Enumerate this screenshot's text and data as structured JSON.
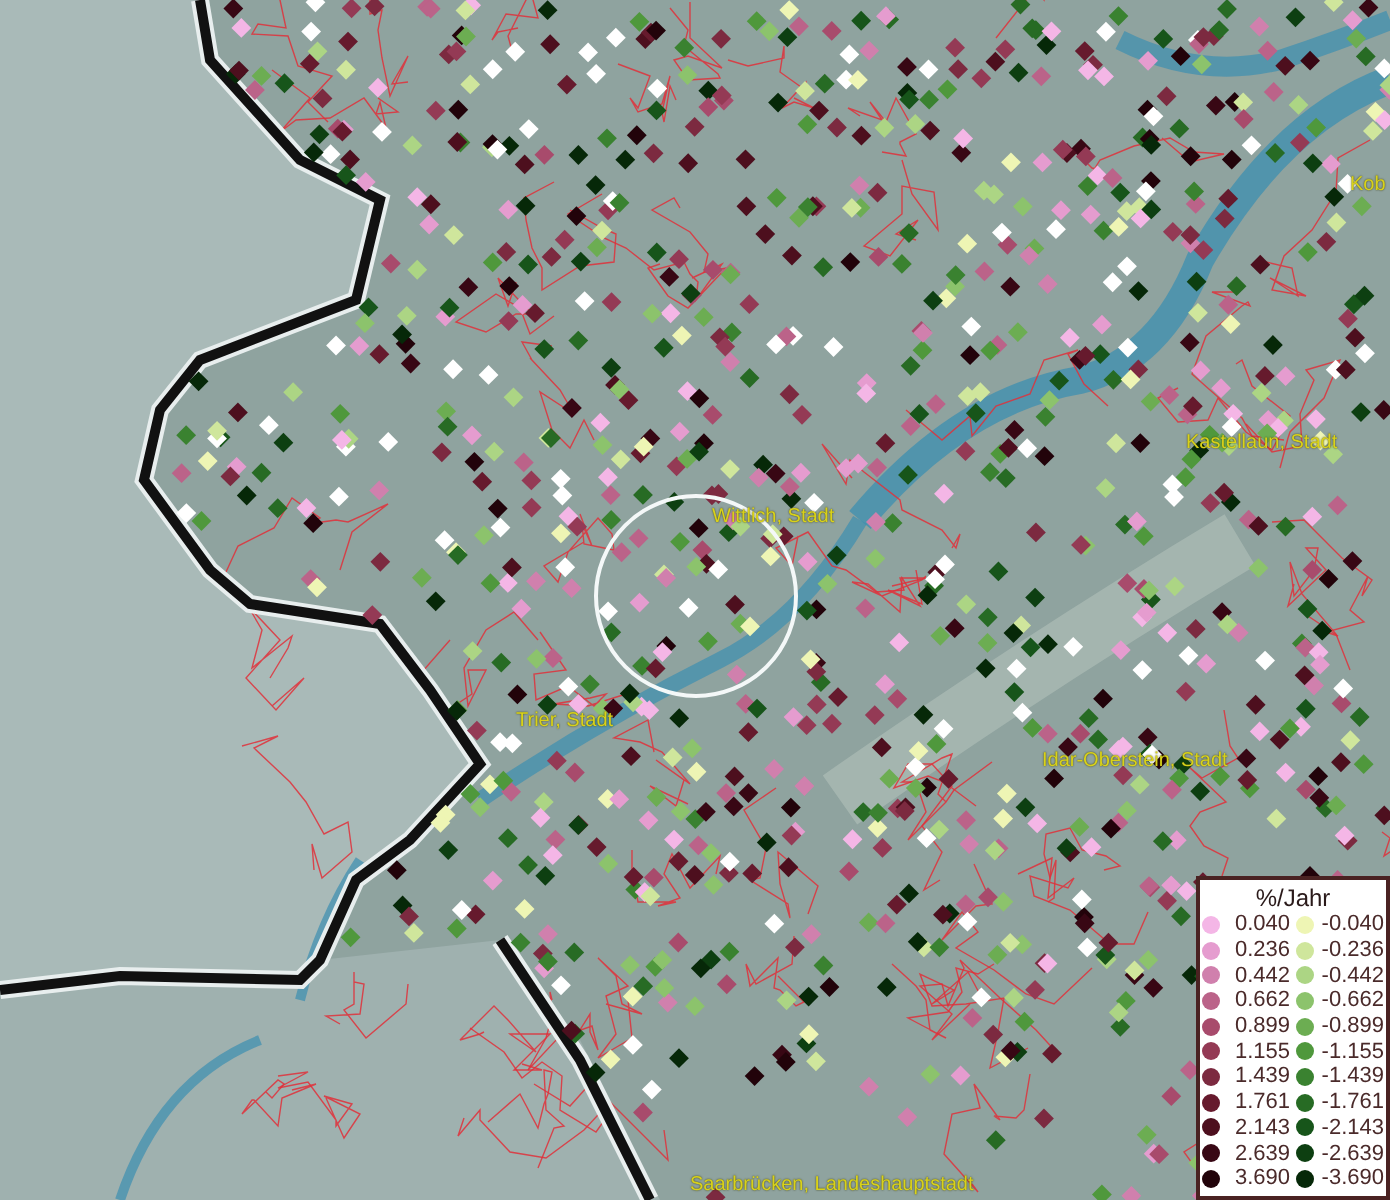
{
  "map": {
    "places": [
      {
        "name": "Kob"
      },
      {
        "name": "Kastellaun, Stadt"
      },
      {
        "name": "Wittlich, Stadt"
      },
      {
        "name": "Trier, Stadt"
      },
      {
        "name": "Idar-Oberstein, Stadt"
      },
      {
        "name": "Saarbrücken, Landeshauptstadt"
      }
    ]
  },
  "legend": {
    "title": "%/Jahr",
    "rows": [
      {
        "positive": {
          "value": "0.040",
          "color": "#f4b6e6"
        },
        "negative": {
          "value": "-0.040",
          "color": "#eef5b4"
        }
      },
      {
        "positive": {
          "value": "0.236",
          "color": "#e59ccf"
        },
        "negative": {
          "value": "-0.236",
          "color": "#cfe69c"
        }
      },
      {
        "positive": {
          "value": "0.442",
          "color": "#d080ad"
        },
        "negative": {
          "value": "-0.442",
          "color": "#acd584"
        }
      },
      {
        "positive": {
          "value": "0.662",
          "color": "#bb6389"
        },
        "negative": {
          "value": "-0.662",
          "color": "#8cc36c"
        }
      },
      {
        "positive": {
          "value": "0.899",
          "color": "#a84b6c"
        },
        "negative": {
          "value": "-0.899",
          "color": "#6cad52"
        }
      },
      {
        "positive": {
          "value": "1.155",
          "color": "#943a55"
        },
        "negative": {
          "value": "-1.155",
          "color": "#4f983c"
        }
      },
      {
        "positive": {
          "value": "1.439",
          "color": "#7c2a40"
        },
        "negative": {
          "value": "-1.439",
          "color": "#3a8230"
        }
      },
      {
        "positive": {
          "value": "1.761",
          "color": "#661a2d"
        },
        "negative": {
          "value": "-1.761",
          "color": "#276b24"
        }
      },
      {
        "positive": {
          "value": "2.143",
          "color": "#4d0f1e"
        },
        "negative": {
          "value": "-2.143",
          "color": "#17551a"
        }
      },
      {
        "positive": {
          "value": "2.639",
          "color": "#380714"
        },
        "negative": {
          "value": "-2.639",
          "color": "#0d3f11"
        }
      },
      {
        "positive": {
          "value": "3.690",
          "color": "#22030a"
        },
        "negative": {
          "value": "-3.690",
          "color": "#062808"
        }
      }
    ]
  }
}
